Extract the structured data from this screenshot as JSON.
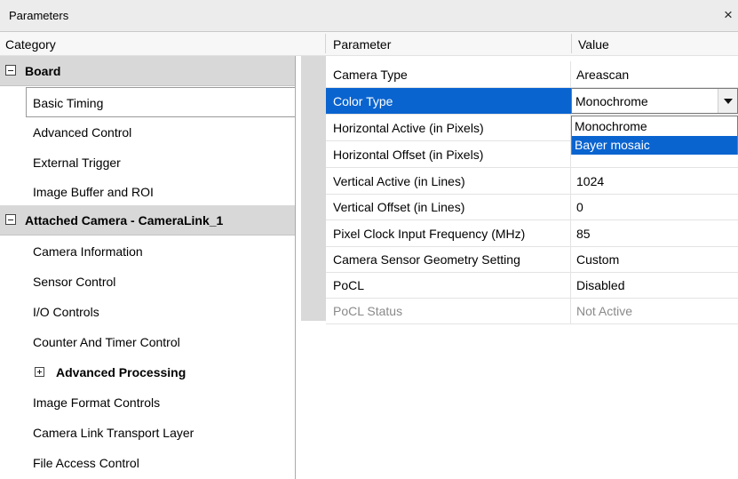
{
  "window": {
    "title": "Parameters",
    "close_glyph": "×"
  },
  "headers": {
    "category": "Category",
    "parameter": "Parameter",
    "value": "Value"
  },
  "categories": [
    {
      "label": "Board",
      "kind": "group",
      "expanded": true
    },
    {
      "label": "Basic Timing",
      "kind": "item",
      "selected": true
    },
    {
      "label": "Advanced Control",
      "kind": "item"
    },
    {
      "label": "External Trigger",
      "kind": "item"
    },
    {
      "label": "Image Buffer and ROI",
      "kind": "item"
    },
    {
      "label": "Attached Camera - CameraLink_1",
      "kind": "group",
      "expanded": true
    },
    {
      "label": "Camera Information",
      "kind": "item"
    },
    {
      "label": "Sensor Control",
      "kind": "item"
    },
    {
      "label": "I/O Controls",
      "kind": "item"
    },
    {
      "label": "Counter And Timer Control",
      "kind": "item"
    },
    {
      "label": "Advanced Processing",
      "kind": "subgroup",
      "expanded": false
    },
    {
      "label": "Image Format Controls",
      "kind": "item"
    },
    {
      "label": "Camera Link Transport Layer",
      "kind": "item"
    },
    {
      "label": "File Access Control",
      "kind": "item"
    }
  ],
  "parameters": [
    {
      "name": "Camera Type",
      "value": "Areascan"
    },
    {
      "name": "Color Type",
      "value": "Monochrome",
      "selected": true
    },
    {
      "name": "Horizontal Active (in Pixels)",
      "value": ""
    },
    {
      "name": "Horizontal Offset (in Pixels)",
      "value": ""
    },
    {
      "name": "Vertical Active (in Lines)",
      "value": "1024"
    },
    {
      "name": "Vertical Offset (in Lines)",
      "value": "0"
    },
    {
      "name": "Pixel Clock Input Frequency (MHz)",
      "value": "85"
    },
    {
      "name": "Camera Sensor Geometry Setting",
      "value": "Custom"
    },
    {
      "name": "PoCL",
      "value": "Disabled"
    },
    {
      "name": "PoCL Status",
      "value": "Not Active",
      "disabled": true
    }
  ],
  "color_type_combo": {
    "selected": "Monochrome",
    "options": [
      "Monochrome",
      "Bayer mosaic"
    ],
    "highlighted": "Bayer mosaic"
  },
  "icons": {
    "close": "close-icon",
    "collapse": "minus-box-icon",
    "expand": "plus-box-icon",
    "dropdown": "chevron-down-icon"
  },
  "colors": {
    "selection": "#0a64d0",
    "group_bg": "#d8d8d8",
    "disabled_text": "#8a8a8a"
  }
}
